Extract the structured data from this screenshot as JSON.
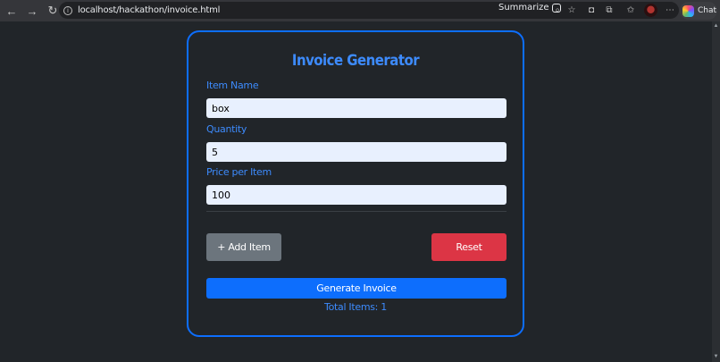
{
  "browser": {
    "url": "localhost/hackathon/invoice.html",
    "summarize_label": "Summarize",
    "chat_label": "Chat"
  },
  "invoice": {
    "title": "Invoice Generator",
    "fields": {
      "item_name": {
        "label": "Item Name",
        "value": "box"
      },
      "quantity": {
        "label": "Quantity",
        "value": "5"
      },
      "price": {
        "label": "Price per Item",
        "value": "100"
      }
    },
    "buttons": {
      "add_item": "+ Add Item",
      "reset": "Reset",
      "generate": "Generate Invoice"
    },
    "total_items": "Total Items: 1"
  },
  "colors": {
    "accent": "#0d6efd",
    "label": "#3d8bfd",
    "danger": "#dc3545",
    "secondary": "#6c757d",
    "page_bg": "#212529"
  }
}
